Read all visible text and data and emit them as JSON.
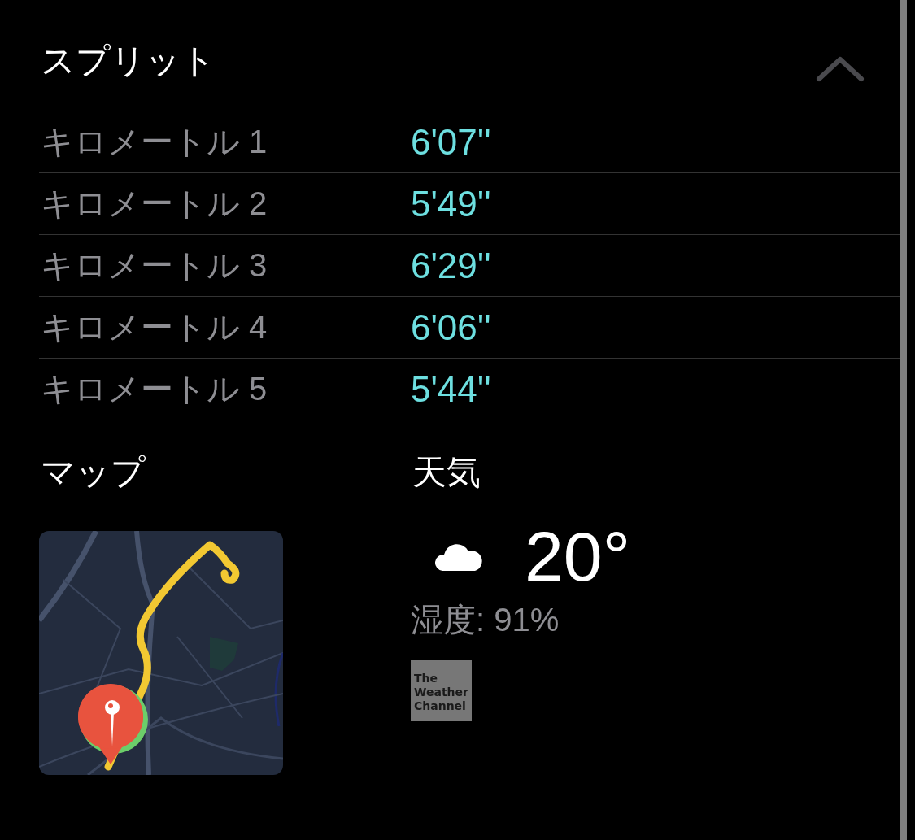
{
  "splits": {
    "title": "スプリット",
    "expanded": true,
    "rows": [
      {
        "label": "キロメートル 1",
        "pace": "6'07''"
      },
      {
        "label": "キロメートル 2",
        "pace": "5'49''"
      },
      {
        "label": "キロメートル 3",
        "pace": "6'29''"
      },
      {
        "label": "キロメートル 4",
        "pace": "6'06''"
      },
      {
        "label": "キロメートル 5",
        "pace": "5'44''"
      }
    ]
  },
  "map": {
    "title": "マップ",
    "kind": "picture"
  },
  "weather": {
    "title": "天気",
    "kind": "cloud",
    "temperature": "20°",
    "humidity": "湿度: 91%",
    "provider": "The Weather Channel"
  }
}
